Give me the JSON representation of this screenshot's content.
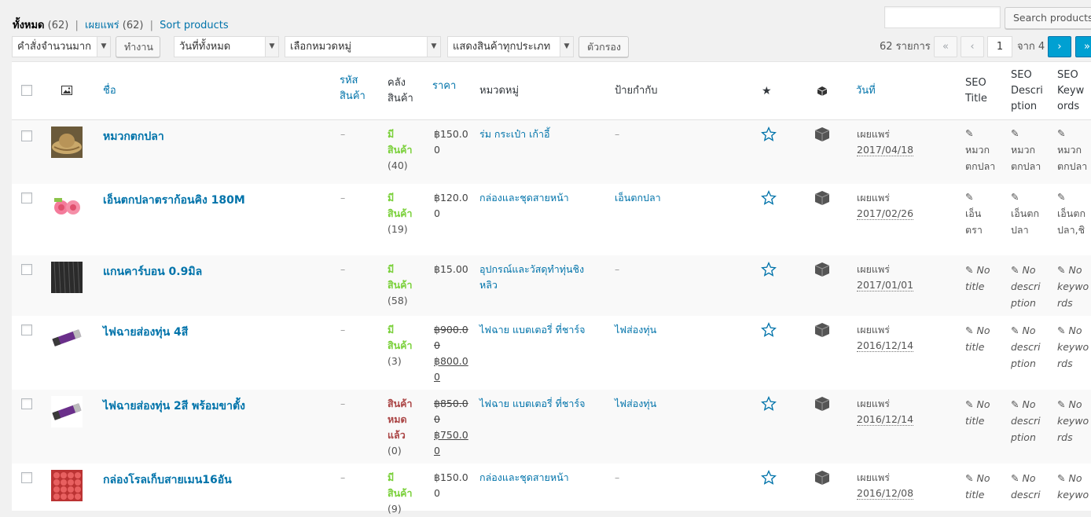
{
  "status_links": {
    "all_label": "ทั้งหมด",
    "all_count": "(62)",
    "published_label": "เผยแพร่",
    "published_count": "(62)",
    "sort_label": "Sort products",
    "separator": "|"
  },
  "search": {
    "button_label": "Search products",
    "value": ""
  },
  "filters": {
    "bulk_action": "คำสั่งจำนวนมาก",
    "apply_label": "ทำงาน",
    "date_filter": "วันที่ทั้งหมด",
    "category_filter": "เลือกหมวดหมู่",
    "type_filter": "แสดงสินค้าทุกประเภท",
    "filter_label": "ตัวกรอง"
  },
  "pagination": {
    "items_text": "62 รายการ",
    "first": "«",
    "prev": "‹",
    "current_page": "1",
    "of_text": "จาก 4",
    "next": "›",
    "last": "»"
  },
  "columns": {
    "name": "ชื่อ",
    "sku_line1": "รหัส",
    "sku_line2": "สินค้า",
    "stock_line1": "คลัง",
    "stock_line2": "สินค้า",
    "price": "ราคา",
    "categories": "หมวดหมู่",
    "tags": "ป้ายกำกับ",
    "date": "วันที่",
    "seo_title_1": "SEO",
    "seo_title_2": "Title",
    "seo_desc_1": "SEO",
    "seo_desc_2": "Descri",
    "seo_desc_3": "ption",
    "seo_kw_1": "SEO",
    "seo_kw_2": "Keyw",
    "seo_kw_3": "ords"
  },
  "rows": [
    {
      "name": "หมวกตกปลา",
      "sku": "–",
      "stock_1": "มี",
      "stock_2": "สินค้า",
      "stock_3": "(40)",
      "stock_status": "in",
      "price_1": "฿150.0",
      "price_2": "0",
      "price_3": "",
      "price_4": "",
      "categories": "ร่ม กระเป๋า เก้าอี้",
      "tags": "–",
      "date_status": "เผยแพร่",
      "date": "2017/04/18",
      "seo_title_1": "หมวก",
      "seo_title_2": "ตกปลา",
      "seo_desc_1": "หมวก",
      "seo_desc_2": "ตกปลา",
      "seo_kw_1": "หมวก",
      "seo_kw_2": "ตกปลา"
    },
    {
      "name": "เอ็นตกปลาตราก้อนคิง 180M",
      "sku": "–",
      "stock_1": "มี",
      "stock_2": "สินค้า",
      "stock_3": "(19)",
      "stock_status": "in",
      "price_1": "฿120.0",
      "price_2": "0",
      "price_3": "",
      "price_4": "",
      "categories": "กล่องและชุดสายหน้า",
      "tags": "เอ็นตกปลา",
      "date_status": "เผยแพร่",
      "date": "2017/02/26",
      "seo_title_1": "เอ็น",
      "seo_title_2": "ตรา",
      "seo_desc_1": "เอ็นตก",
      "seo_desc_2": "ปลา",
      "seo_kw_1": "เอ็นตก",
      "seo_kw_2": "ปลา,ชิ"
    },
    {
      "name": "แกนคาร์บอน 0.9มิล",
      "sku": "–",
      "stock_1": "มี",
      "stock_2": "สินค้า",
      "stock_3": "(58)",
      "stock_status": "in",
      "price_1": "฿15.00",
      "price_2": "",
      "price_3": "",
      "price_4": "",
      "categories": "อุปกรณ์และวัสดุทำทุ่นชิงหลิว",
      "tags": "–",
      "date_status": "เผยแพร่",
      "date": "2017/01/01",
      "seo_title_1": "No",
      "seo_title_2": "title",
      "seo_desc_1": "No",
      "seo_desc_2": "descri",
      "seo_desc_3": "ption",
      "seo_kw_1": "No",
      "seo_kw_2": "keywo",
      "seo_kw_3": "rds"
    },
    {
      "name": "ไฟฉายส่องทุ่น 4สี",
      "sku": "–",
      "stock_1": "มี",
      "stock_2": "สินค้า",
      "stock_3": "(3)",
      "stock_status": "in",
      "price_1": "฿900.0",
      "price_2": "0",
      "price_3": "฿800.0",
      "price_4": "0",
      "categories": "ไฟฉาย แบตเตอรี่ ที่ชาร์จ",
      "tags": "ไฟส่องทุ่น",
      "date_status": "เผยแพร่",
      "date": "2016/12/14",
      "seo_title_1": "No",
      "seo_title_2": "title",
      "seo_desc_1": "No",
      "seo_desc_2": "descri",
      "seo_desc_3": "ption",
      "seo_kw_1": "No",
      "seo_kw_2": "keywo",
      "seo_kw_3": "rds"
    },
    {
      "name": "ไฟฉายส่องทุ่น 2สี พร้อมขาตั้ง",
      "sku": "–",
      "stock_1": "สินค้า",
      "stock_2": "หมด",
      "stock_2b": "แล้ว",
      "stock_3": "(0)",
      "stock_status": "out",
      "price_1": "฿850.0",
      "price_2": "0",
      "price_3": "฿750.0",
      "price_4": "0",
      "categories": "ไฟฉาย แบตเตอรี่ ที่ชาร์จ",
      "tags": "ไฟส่องทุ่น",
      "date_status": "เผยแพร่",
      "date": "2016/12/14",
      "seo_title_1": "No",
      "seo_title_2": "title",
      "seo_desc_1": "No",
      "seo_desc_2": "descri",
      "seo_desc_3": "ption",
      "seo_kw_1": "No",
      "seo_kw_2": "keywo",
      "seo_kw_3": "rds"
    },
    {
      "name": "กล่องโรลเก็บสายเมน16อัน",
      "sku": "–",
      "stock_1": "มี",
      "stock_2": "สินค้า",
      "stock_3": "(9)",
      "stock_status": "in",
      "price_1": "฿150.0",
      "price_2": "0",
      "price_3": "",
      "price_4": "",
      "categories": "กล่องและชุดสายหน้า",
      "tags": "–",
      "date_status": "เผยแพร่",
      "date": "2016/12/08",
      "seo_title_1": "No",
      "seo_title_2": "title",
      "seo_desc_1": "No",
      "seo_desc_2": "descri",
      "seo_desc_3": "ption",
      "seo_kw_1": "No",
      "seo_kw_2": "keywo",
      "seo_kw_3": "rds"
    }
  ]
}
